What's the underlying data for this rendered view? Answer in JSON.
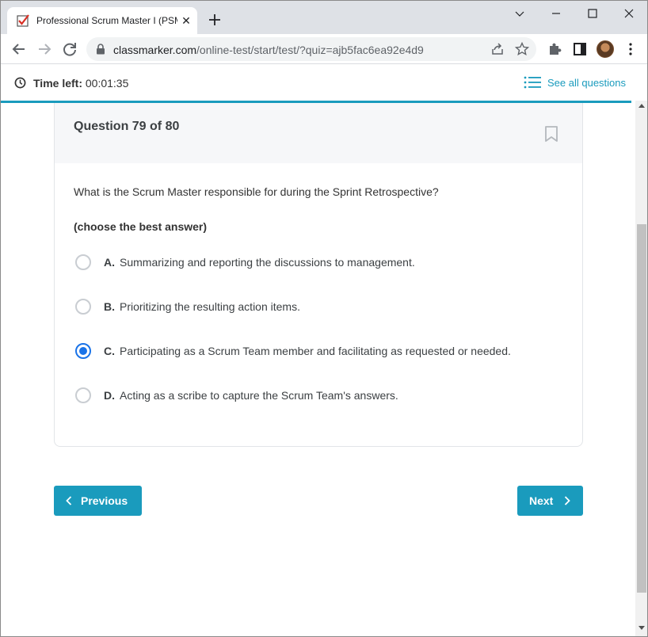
{
  "browser": {
    "tab_title": "Professional Scrum Master I (PSM",
    "url_host": "classmarker.com",
    "url_path": "/online-test/start/test/?quiz=ajb5fac6ea92e4d9"
  },
  "header": {
    "time_label": "Time left:",
    "time_value": "00:01:35",
    "see_all_label": "See all questions"
  },
  "question": {
    "number_label": "Question 79 of 80",
    "text": "What is the Scrum Master responsible for during the Sprint Retrospective?",
    "hint": "(choose the best answer)",
    "options": [
      {
        "letter": "A.",
        "text": "Summarizing and reporting the discussions to management.",
        "selected": false
      },
      {
        "letter": "B.",
        "text": "Prioritizing the resulting action items.",
        "selected": false
      },
      {
        "letter": "C.",
        "text": "Participating as a Scrum Team member and facilitating as requested or needed.",
        "selected": true
      },
      {
        "letter": "D.",
        "text": "Acting as a scribe to capture the Scrum Team's answers.",
        "selected": false
      }
    ]
  },
  "navigation": {
    "previous_label": "Previous",
    "next_label": "Next"
  },
  "colors": {
    "accent": "#1a9bbd",
    "radio_selected": "#1a73e8"
  }
}
